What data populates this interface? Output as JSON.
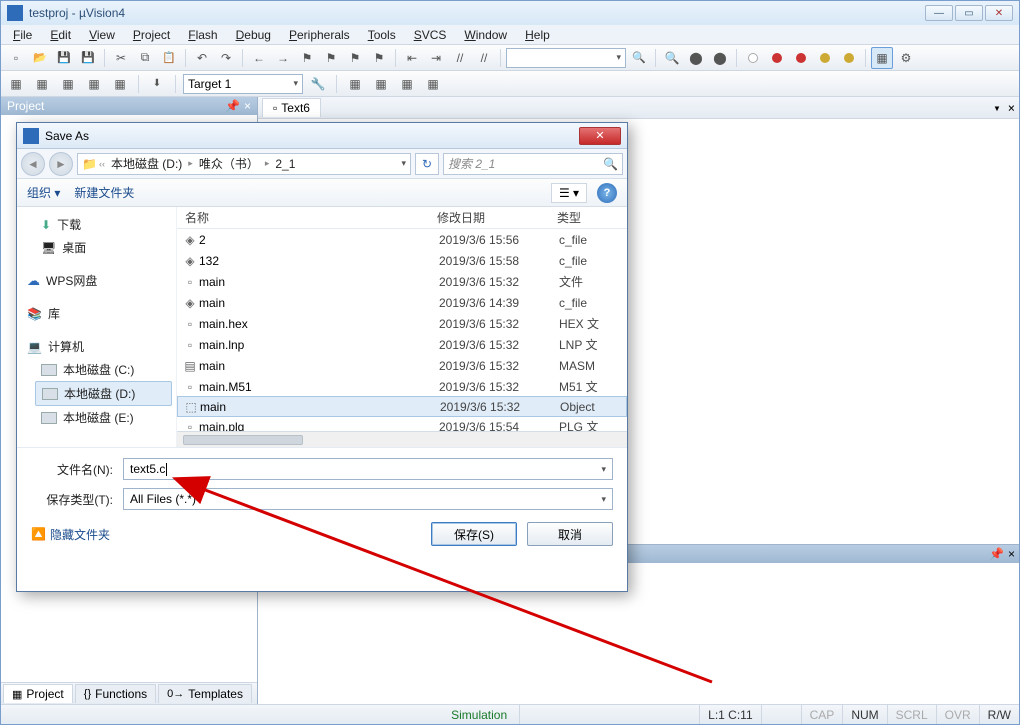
{
  "title": "testproj  - µVision4",
  "menu": [
    "File",
    "Edit",
    "View",
    "Project",
    "Flash",
    "Debug",
    "Peripherals",
    "Tools",
    "SVCS",
    "Window",
    "Help"
  ],
  "target": "Target 1",
  "project_panel_title": "Project",
  "doc_tab": "Text6",
  "panel_tabs": {
    "project": "Project",
    "functions": "Functions",
    "templates": "Templates"
  },
  "statusbar": {
    "sim": "Simulation",
    "cursor": "L:1 C:11",
    "caps": "CAP",
    "num": "NUM",
    "scrl": "SCRL",
    "ovr": "OVR",
    "rw": "R/W"
  },
  "dialog": {
    "title": "Save As",
    "breadcrumb": [
      "本地磁盘 (D:)",
      "唯众（书）",
      "2_1"
    ],
    "search_placeholder": "搜索 2_1",
    "organize": "组织 ▾",
    "new_folder": "新建文件夹",
    "tree": [
      {
        "label": "下载",
        "glyph": "down",
        "indent": true
      },
      {
        "label": "桌面",
        "glyph": "desktop",
        "indent": true
      },
      {
        "spacer": true
      },
      {
        "label": "WPS网盘",
        "glyph": "cloud"
      },
      {
        "spacer": true
      },
      {
        "label": "库",
        "glyph": "lib"
      },
      {
        "spacer": true
      },
      {
        "label": "计算机",
        "glyph": "pc"
      },
      {
        "label": "本地磁盘 (C:)",
        "glyph": "drive",
        "indent": true
      },
      {
        "label": "本地磁盘 (D:)",
        "glyph": "drive",
        "indent": true,
        "selected": true
      },
      {
        "label": "本地磁盘 (E:)",
        "glyph": "drive",
        "indent": true
      }
    ],
    "columns": {
      "name": "名称",
      "date": "修改日期",
      "type": "类型"
    },
    "files": [
      {
        "icon": "◈",
        "name": "2",
        "date": "2019/3/6 15:56",
        "type": "c_file"
      },
      {
        "icon": "◈",
        "name": "132",
        "date": "2019/3/6 15:58",
        "type": "c_file"
      },
      {
        "icon": "▫",
        "name": "main",
        "date": "2019/3/6 15:32",
        "type": "文件"
      },
      {
        "icon": "◈",
        "name": "main",
        "date": "2019/3/6 14:39",
        "type": "c_file"
      },
      {
        "icon": "▫",
        "name": "main.hex",
        "date": "2019/3/6 15:32",
        "type": "HEX 文"
      },
      {
        "icon": "▫",
        "name": "main.lnp",
        "date": "2019/3/6 15:32",
        "type": "LNP 文"
      },
      {
        "icon": "▤",
        "name": "main",
        "date": "2019/3/6 15:32",
        "type": "MASM"
      },
      {
        "icon": "▫",
        "name": "main.M51",
        "date": "2019/3/6 15:32",
        "type": "M51 文"
      },
      {
        "icon": "⬚",
        "name": "main",
        "date": "2019/3/6 15:32",
        "type": "Object",
        "selected": true
      },
      {
        "icon": "▫",
        "name": "main.plg",
        "date": "2019/3/6 15:54",
        "type": "PLG 文"
      }
    ],
    "filename_label": "文件名(N):",
    "filename_value": "text5.c",
    "filetype_label": "保存类型(T):",
    "filetype_value": "All Files (*.*)",
    "hide_folders": "隐藏文件夹",
    "save_btn": "保存(S)",
    "cancel_btn": "取消"
  }
}
